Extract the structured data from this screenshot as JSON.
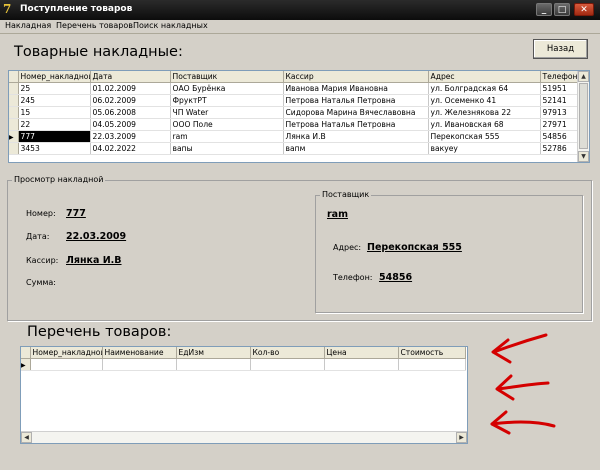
{
  "window": {
    "title": "Поступление товаров",
    "icon": "app-icon"
  },
  "menu": [
    "Накладная",
    "Перечень товаров",
    "Поиск накладных"
  ],
  "heading_invoices": "Товарные накладные:",
  "back_button": "Назад",
  "invoices_grid": {
    "columns": [
      "Номер_накладной",
      "Дата",
      "Поставщик",
      "Кассир",
      "Адрес",
      "Телефон"
    ],
    "rows": [
      [
        "25",
        "01.02.2009",
        "ОАО Бурёнка",
        "Иванова Мария Ивановна",
        "ул. Болградская 64",
        "51951"
      ],
      [
        "245",
        "06.02.2009",
        "ФруктРТ",
        "Петрова Наталья Петровна",
        "ул. Осеменко 41",
        "52141"
      ],
      [
        "15",
        "05.06.2008",
        "ЧП Water",
        "Сидорова Марина Вячеславовна",
        "ул. Железнякова 22",
        "97913"
      ],
      [
        "22",
        "04.05.2009",
        "ООО Поле",
        "Петрова Наталья Петровна",
        "ул. Ивановская 68",
        "27971"
      ],
      [
        "777",
        "22.03.2009",
        "ram",
        "Лянка И.В",
        "Перекопская 555",
        "54856"
      ],
      [
        "3453",
        "04.02.2022",
        "вапы",
        "вапм",
        "вакуеу",
        "52786"
      ]
    ],
    "selected_row": 4
  },
  "view_group": {
    "caption": "Просмотр накладной",
    "number_label": "Номер:",
    "number_value": "777",
    "date_label": "Дата:",
    "date_value": "22.03.2009",
    "cashier_label": "Кассир:",
    "cashier_value": "Лянка И.В",
    "sum_label": "Сумма:"
  },
  "supplier_group": {
    "caption": "Поставщик",
    "name_value": "ram",
    "address_label": "Адрес:",
    "address_value": "Перекопская 555",
    "phone_label": "Телефон:",
    "phone_value": "54856"
  },
  "heading_goods": "Перечень товаров:",
  "goods_grid": {
    "columns": [
      "Номер_накладной",
      "Наименование",
      "ЕдИзм",
      "Кол-во",
      "Цена",
      "Стоимость"
    ]
  },
  "annotation_color": "#d40000"
}
